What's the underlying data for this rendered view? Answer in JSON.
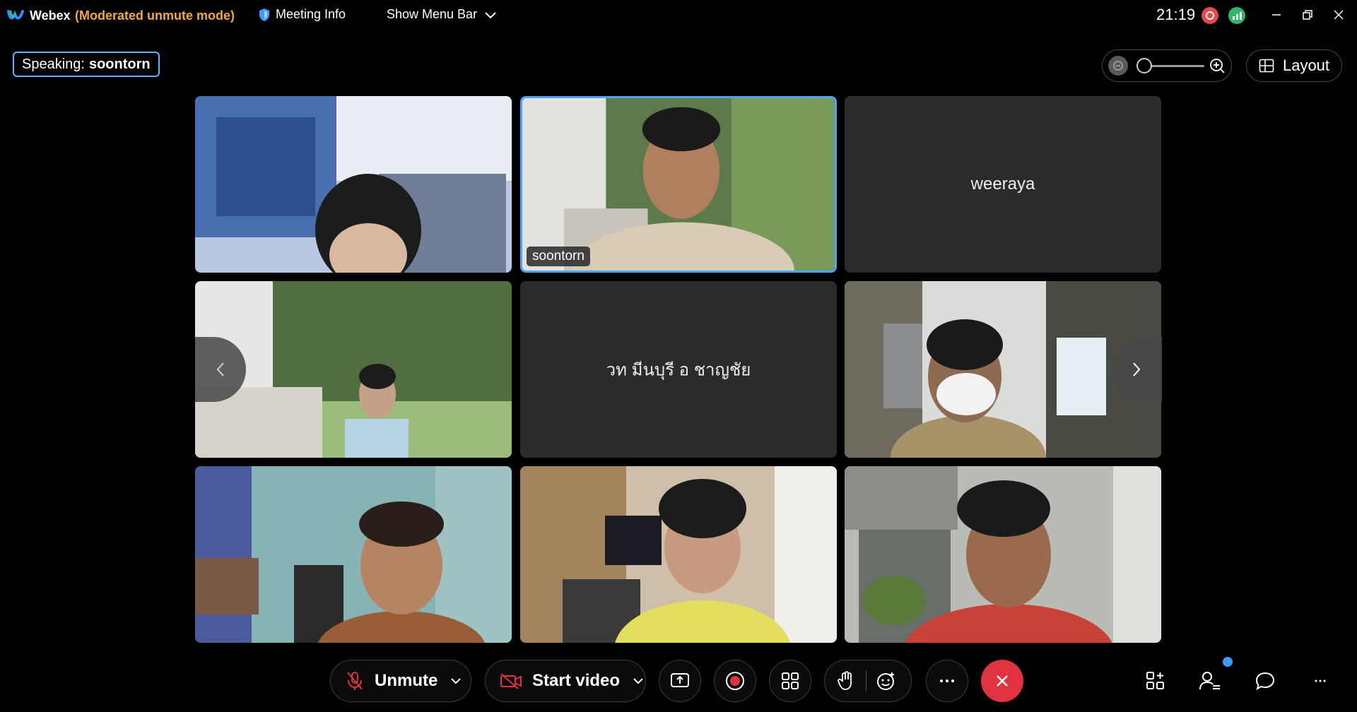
{
  "titlebar": {
    "app_name": "Webex",
    "mode": "(Moderated unmute mode)",
    "meeting_info_label": "Meeting Info",
    "show_menu_label": "Show Menu Bar",
    "clock": "21:19"
  },
  "speaking": {
    "prefix": "Speaking:",
    "name": "soontorn"
  },
  "view": {
    "layout_label": "Layout"
  },
  "participants": [
    {
      "name": "",
      "video": true
    },
    {
      "name": "soontorn",
      "video": true,
      "active_speaker": true
    },
    {
      "name": "weeraya",
      "video": false
    },
    {
      "name": "",
      "video": true
    },
    {
      "name": "วท มีนบุรี อ ชาญชัย",
      "video": false
    },
    {
      "name": "",
      "video": true
    },
    {
      "name": "",
      "video": true
    },
    {
      "name": "",
      "video": true
    },
    {
      "name": "",
      "video": true
    }
  ],
  "controls": {
    "unmute_label": "Unmute",
    "start_video_label": "Start video"
  },
  "colors": {
    "accent_blue": "#4aa3ff",
    "mode_orange": "#f0a93b",
    "end_call_red": "#e0333f",
    "tile_bg": "#2b2b2b"
  },
  "icons": [
    "webex-logo-icon",
    "shield-icon",
    "chevron-down-icon",
    "record-icon",
    "signal-icon",
    "minimize-icon",
    "restore-icon",
    "close-icon",
    "zoom-out-icon",
    "zoom-in-icon",
    "layout-grid-icon",
    "chevron-left-icon",
    "chevron-right-icon",
    "mic-muted-icon",
    "video-off-icon",
    "share-icon",
    "record-button-icon",
    "apps-icon",
    "raise-hand-icon",
    "reactions-icon",
    "more-icon",
    "end-call-icon",
    "add-apps-icon",
    "participants-icon",
    "chat-icon"
  ]
}
